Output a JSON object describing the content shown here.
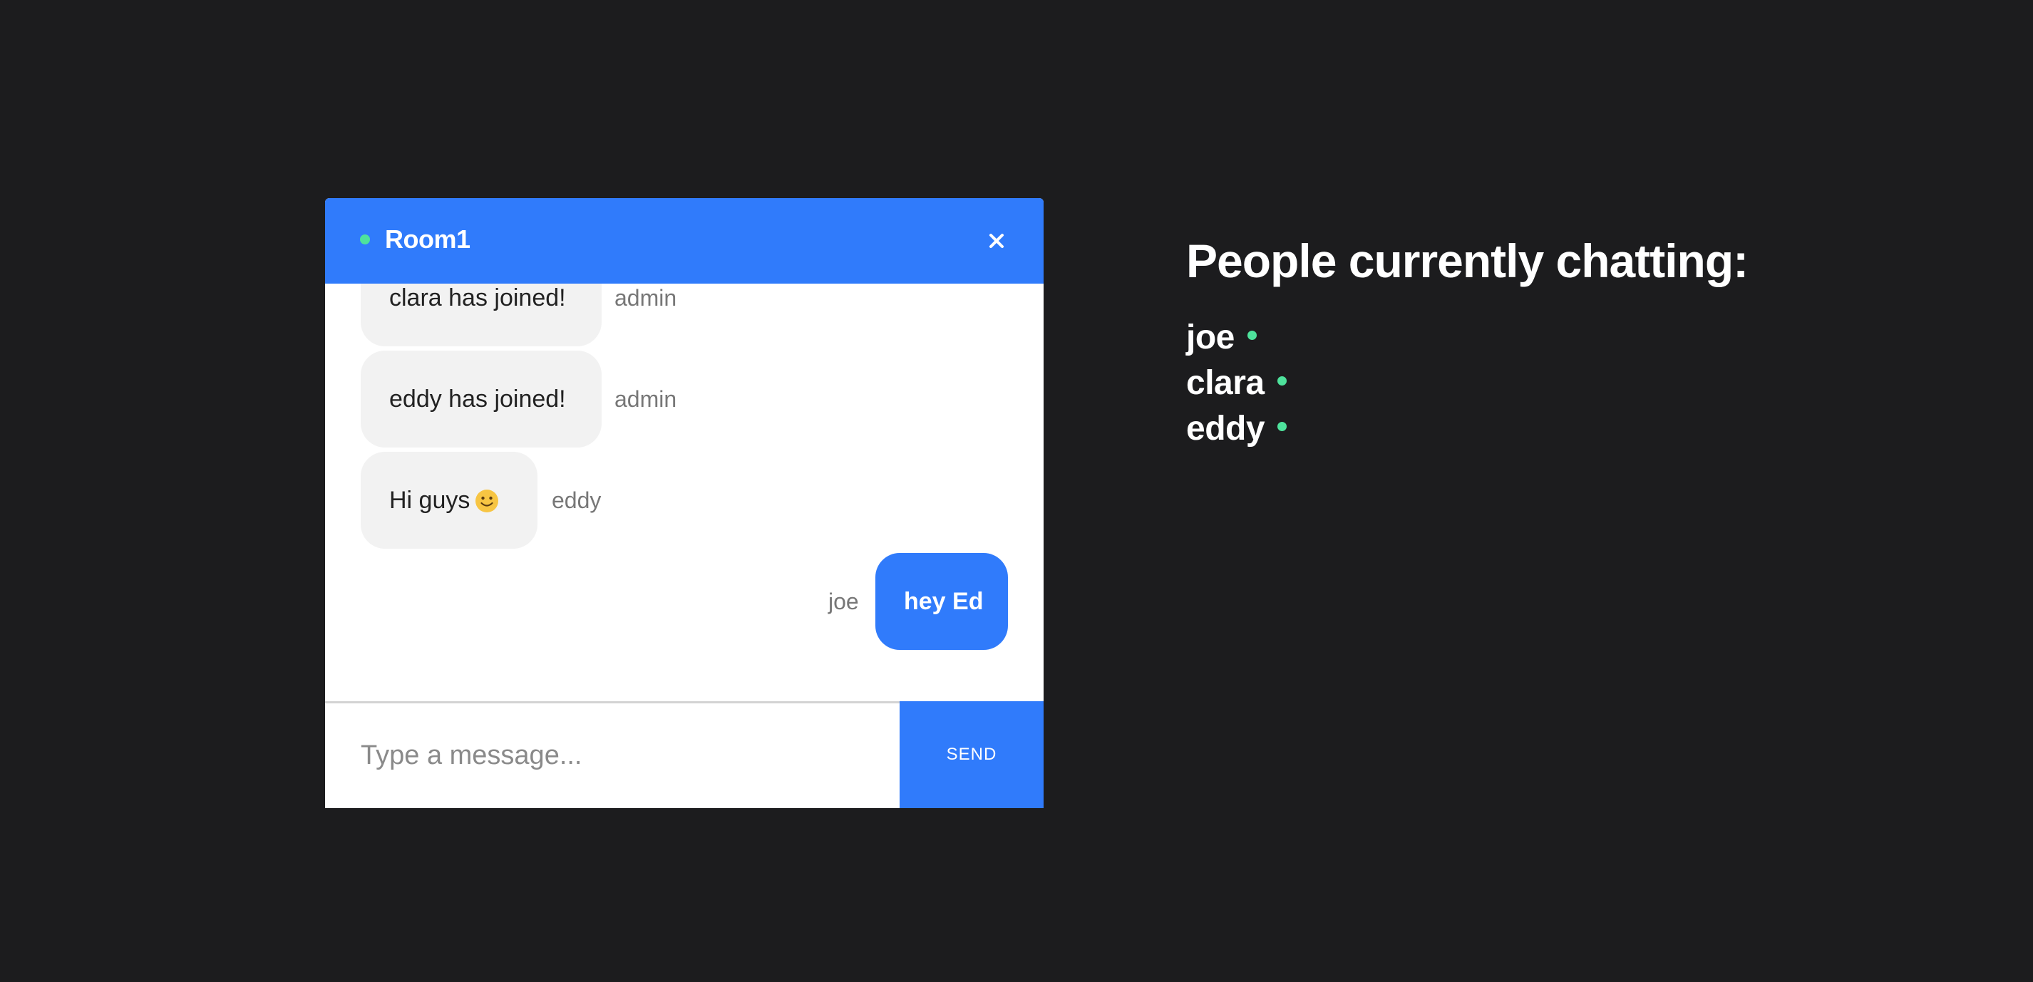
{
  "room": {
    "title": "Room1",
    "status_color": "#4ee29c",
    "close_icon": "close-icon"
  },
  "messages": [
    {
      "text": "clara has joined!",
      "sender": "admin",
      "direction": "incoming"
    },
    {
      "text": "eddy has joined!",
      "sender": "admin",
      "direction": "incoming"
    },
    {
      "text": "Hi guys",
      "emoji": "slightly-smiling-face",
      "sender": "eddy",
      "direction": "incoming"
    },
    {
      "text": "hey Ed",
      "sender": "joe",
      "direction": "outgoing"
    }
  ],
  "composer": {
    "placeholder": "Type a message...",
    "send_label": "SEND"
  },
  "people": {
    "title": "People currently chatting:",
    "users": [
      "joe",
      "clara",
      "eddy"
    ],
    "online_color": "#4ee29c"
  },
  "colors": {
    "background": "#1c1c1e",
    "accent": "#307bfb",
    "bubble_incoming": "#f2f2f2"
  }
}
